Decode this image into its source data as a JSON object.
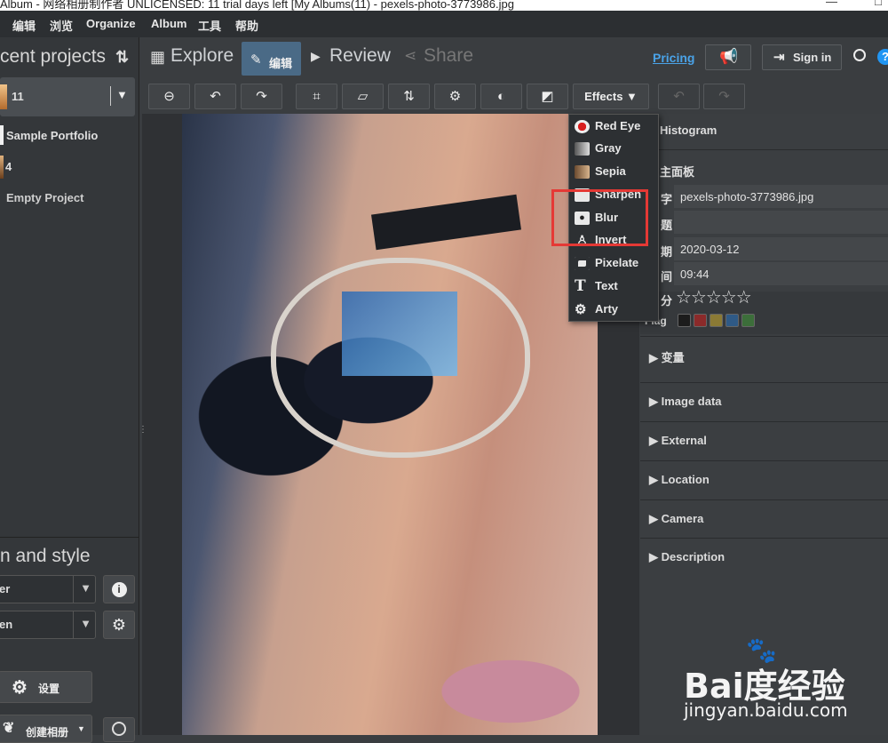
{
  "titlebar": {
    "title": "Album - 网络相册制作者 UNLICENSED: 11 trial days left [My Albums(11) - pexels-photo-3773986.jpg"
  },
  "menu": [
    "编辑",
    "浏览",
    "Organize",
    "Album",
    "工具",
    "帮助"
  ],
  "left": {
    "recent_title": "cent projects",
    "sort_icon": "⇅",
    "projects": [
      {
        "count": "11"
      },
      {
        "name": "Sample Portfolio"
      },
      {
        "count": "4"
      },
      {
        "name": "Empty Project"
      }
    ],
    "style_title": "n and style",
    "select1": "er",
    "select2": "en",
    "settings_label": "设置",
    "create_label": "创建相册"
  },
  "nav": {
    "explore": "Explore",
    "edit": "编辑",
    "review": "Review",
    "share": "Share",
    "pricing": "Pricing",
    "sign_in": "Sign in"
  },
  "toolbar": {
    "effects_label": "Effects ▼"
  },
  "effects_menu": [
    "Red Eye",
    "Gray",
    "Sepia",
    "Sharpen",
    "Blur",
    "Invert",
    "Pixelate",
    "Text",
    "Arty"
  ],
  "right": {
    "histogram": "Histogram",
    "main_panel": "主面板",
    "labels": {
      "name": "字",
      "title": "题",
      "date": "期",
      "time": "间",
      "rating": "分",
      "flag": "Flag"
    },
    "filename": "pexels-photo-3773986.jpg",
    "date": "2020-03-12",
    "time": "09:44",
    "stars": "☆☆☆☆☆",
    "sections": [
      "变量",
      "Image data",
      "External",
      "Location",
      "Camera",
      "Description"
    ]
  },
  "flag_colors": [
    "#1c1c1c",
    "#8b2a2a",
    "#8b7a35",
    "#2f5a86",
    "#3c6e3a"
  ],
  "watermark": {
    "logo": "Bai度经验",
    "url": "jingyan.baidu.com"
  }
}
